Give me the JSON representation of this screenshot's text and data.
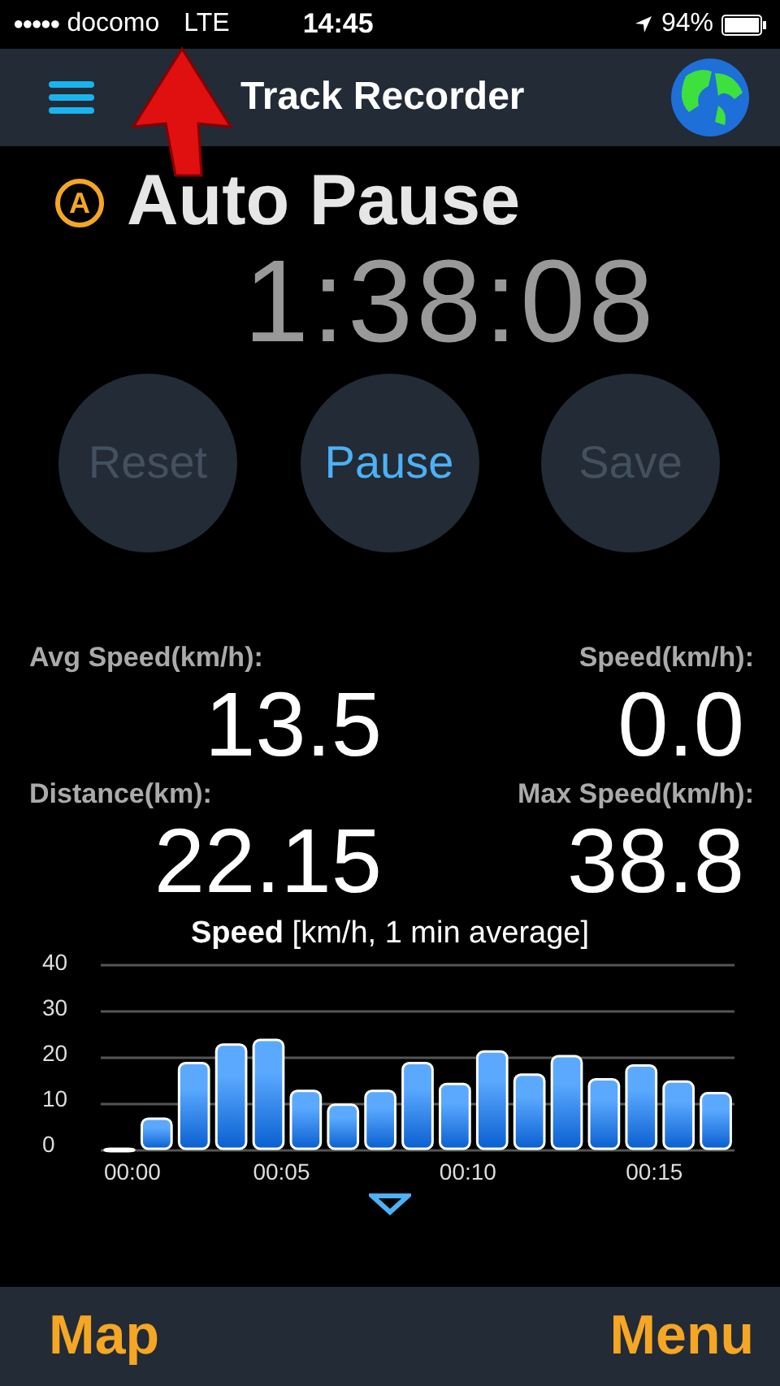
{
  "status_bar": {
    "signal_dots": "●●●●●",
    "carrier": "docomo",
    "network": "LTE",
    "time": "14:45",
    "battery": "94%"
  },
  "nav": {
    "title": "Track Recorder"
  },
  "timer": {
    "time": "1:38:08",
    "auto_pause_label": "Auto Pause",
    "auto_badge": "A"
  },
  "buttons": [
    {
      "label": "Reset",
      "disabled": true
    },
    {
      "label": "Pause",
      "disabled": false
    },
    {
      "label": "Save",
      "disabled": true
    }
  ],
  "stats": [
    {
      "label": "Avg Speed(km/h):",
      "value": "13.5"
    },
    {
      "label": "Speed(km/h):",
      "value": "0.0"
    },
    {
      "label": "Distance(km):",
      "value": "22.15"
    },
    {
      "label": "Max Speed(km/h):",
      "value": "38.8"
    }
  ],
  "chart": {
    "title": "**Speed** [km/h, 1 min average]",
    "chart_data": {
      "type": "bar",
      "categories": [
        "00:00",
        null,
        null,
        null,
        "00:05",
        null,
        null,
        null,
        null,
        "00:10",
        null,
        null,
        null,
        null,
        "00:15",
        null,
        null
      ],
      "values": [
        0,
        6.5,
        18.5,
        22.5,
        23.5,
        12.5,
        9.5,
        12.5,
        18.5,
        14,
        21,
        16,
        20,
        15,
        18,
        14.5,
        12
      ],
      "ylim": [
        0,
        40
      ],
      "yticks": [
        0,
        10,
        20,
        30,
        40
      ],
      "grid": true
    }
  },
  "tab_bar": {
    "left": "Map",
    "right": "Menu"
  }
}
